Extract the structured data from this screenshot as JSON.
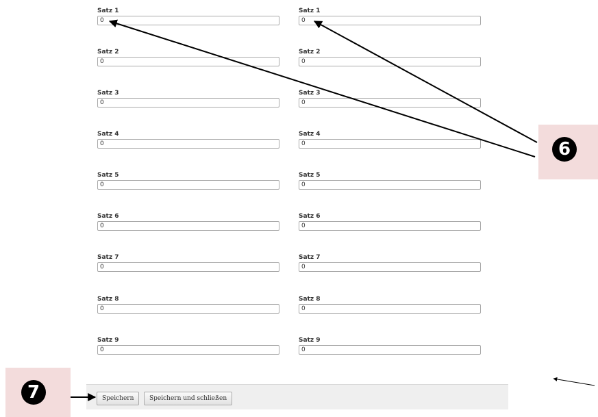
{
  "form": {
    "left_column": [
      {
        "label": "Satz 1",
        "value": "0"
      },
      {
        "label": "Satz 2",
        "value": "0"
      },
      {
        "label": "Satz 3",
        "value": "0"
      },
      {
        "label": "Satz 4",
        "value": "0"
      },
      {
        "label": "Satz 5",
        "value": "0"
      },
      {
        "label": "Satz 6",
        "value": "0"
      },
      {
        "label": "Satz 7",
        "value": "0"
      },
      {
        "label": "Satz 8",
        "value": "0"
      },
      {
        "label": "Satz 9",
        "value": "0"
      }
    ],
    "right_column": [
      {
        "label": "Satz 1",
        "value": "0"
      },
      {
        "label": "Satz 2",
        "value": "0"
      },
      {
        "label": "Satz 3",
        "value": "0"
      },
      {
        "label": "Satz 4",
        "value": "0"
      },
      {
        "label": "Satz 5",
        "value": "0"
      },
      {
        "label": "Satz 6",
        "value": "0"
      },
      {
        "label": "Satz 7",
        "value": "0"
      },
      {
        "label": "Satz 8",
        "value": "0"
      },
      {
        "label": "Satz 9",
        "value": "0"
      }
    ]
  },
  "toolbar": {
    "save_label": "Speichern",
    "save_close_label": "Speichern und schließen"
  },
  "callouts": {
    "six": "6",
    "seven": "7"
  },
  "colors": {
    "callout_background": "#f3dcdc",
    "callout_circle": "#000000",
    "toolbar_background": "#efefef"
  }
}
